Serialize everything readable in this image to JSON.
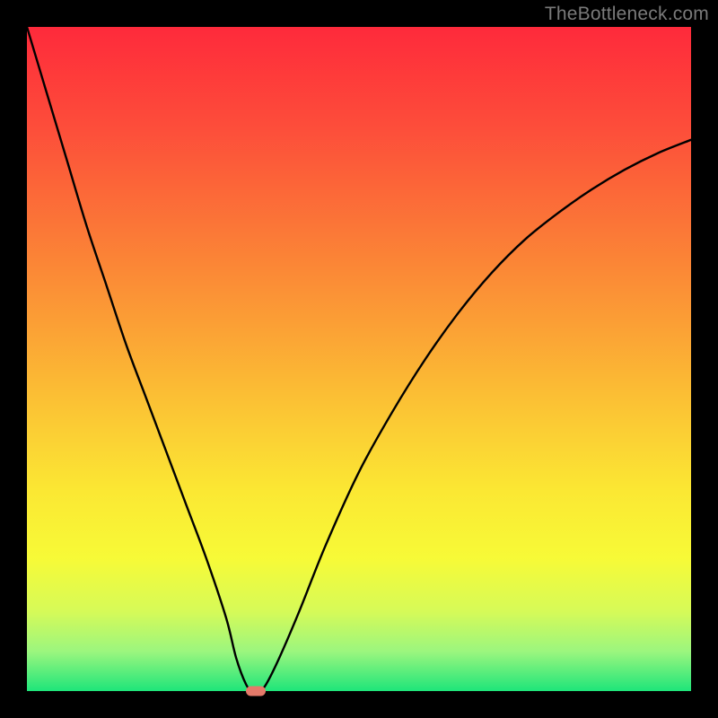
{
  "watermark": "TheBottleneck.com",
  "chart_data": {
    "type": "line",
    "title": "",
    "xlabel": "",
    "ylabel": "",
    "xlim": [
      0,
      100
    ],
    "ylim": [
      0,
      100
    ],
    "grid": false,
    "legend": false,
    "background_gradient": {
      "stops": [
        {
          "offset": 0.0,
          "color": "#fe2a3b"
        },
        {
          "offset": 0.15,
          "color": "#fd4d3a"
        },
        {
          "offset": 0.3,
          "color": "#fb7637"
        },
        {
          "offset": 0.45,
          "color": "#fba035"
        },
        {
          "offset": 0.58,
          "color": "#fbc634"
        },
        {
          "offset": 0.7,
          "color": "#fbe833"
        },
        {
          "offset": 0.8,
          "color": "#f7fa37"
        },
        {
          "offset": 0.88,
          "color": "#d6fa58"
        },
        {
          "offset": 0.94,
          "color": "#9cf67e"
        },
        {
          "offset": 1.0,
          "color": "#1ee57a"
        }
      ]
    },
    "series": [
      {
        "name": "bottleneck-curve",
        "x": [
          0,
          3,
          6,
          9,
          12,
          15,
          18,
          21,
          24,
          27,
          30,
          31.5,
          33,
          34,
          35,
          36,
          38,
          41,
          45,
          50,
          55,
          60,
          65,
          70,
          75,
          80,
          85,
          90,
          95,
          100
        ],
        "y": [
          100,
          90,
          80,
          70,
          61,
          52,
          44,
          36,
          28,
          20,
          11,
          5,
          1,
          0,
          0,
          1,
          5,
          12,
          22,
          33,
          42,
          50,
          57,
          63,
          68,
          72,
          75.5,
          78.5,
          81,
          83
        ]
      }
    ],
    "marker": {
      "x": 34.5,
      "y": 0,
      "color": "#e47a6a"
    }
  }
}
